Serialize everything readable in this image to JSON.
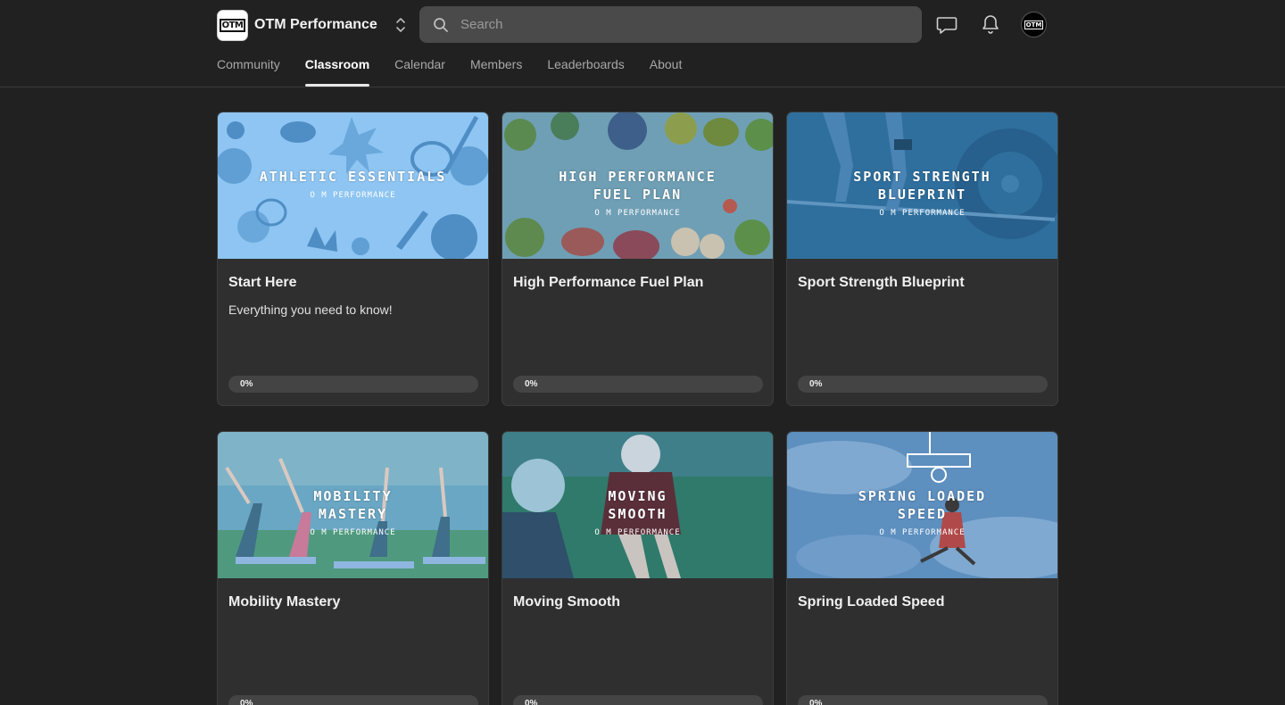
{
  "header": {
    "logo_text": "OTM",
    "brand_name": "OTM Performance",
    "search_placeholder": "Search",
    "avatar_text": "OTM"
  },
  "nav": {
    "tabs": [
      {
        "label": "Community"
      },
      {
        "label": "Classroom",
        "active": true
      },
      {
        "label": "Calendar"
      },
      {
        "label": "Members"
      },
      {
        "label": "Leaderboards"
      },
      {
        "label": "About"
      }
    ]
  },
  "courses": [
    {
      "cover_title": "Athletic Essentials",
      "cover_sub": "O M Performance",
      "title": "Start Here",
      "description": "Everything you need to know!",
      "progress": 0,
      "progress_label": "0%",
      "cover_color": "#8ec5f2"
    },
    {
      "cover_title": "High Performance Fuel Plan",
      "cover_sub": "O M Performance",
      "title": "High Performance Fuel Plan",
      "description": "",
      "progress": 0,
      "progress_label": "0%",
      "cover_color": "#6f9fb5"
    },
    {
      "cover_title": "Sport Strength Blueprint",
      "cover_sub": "O M Performance",
      "title": "Sport Strength Blueprint",
      "description": "",
      "progress": 0,
      "progress_label": "0%",
      "cover_color": "#2f6f9e"
    },
    {
      "cover_title": "Mobility Mastery",
      "cover_sub": "O M Performance",
      "title": "Mobility Mastery",
      "description": "",
      "progress": 0,
      "progress_label": "0%",
      "cover_color": "#6aa7c4"
    },
    {
      "cover_title": "Moving Smooth",
      "cover_sub": "O M Performance",
      "title": "Moving Smooth",
      "description": "",
      "progress": 0,
      "progress_label": "0%",
      "cover_color": "#2f6f80"
    },
    {
      "cover_title": "Spring Loaded Speed",
      "cover_sub": "O M Performance",
      "title": "Spring Loaded Speed",
      "description": "",
      "progress": 0,
      "progress_label": "0%",
      "cover_color": "#5d8fbf"
    }
  ]
}
